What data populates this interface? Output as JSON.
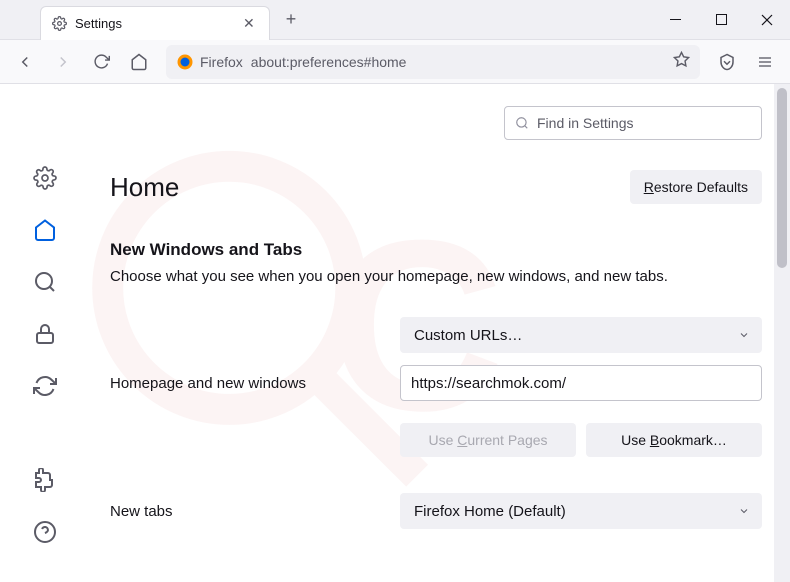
{
  "tab": {
    "title": "Settings"
  },
  "urlbar": {
    "identity": "Firefox",
    "url": "about:preferences#home"
  },
  "search": {
    "placeholder": "Find in Settings"
  },
  "page": {
    "heading": "Home",
    "restore": "Restore Defaults",
    "section_title": "New Windows and Tabs",
    "section_desc": "Choose what you see when you open your homepage, new windows, and new tabs.",
    "homepage_label": "Homepage and new windows",
    "homepage_mode": "Custom URLs…",
    "homepage_value": "https://searchmok.com/",
    "use_current": "Use Current Pages",
    "use_bookmark": "Use Bookmark…",
    "newtabs_label": "New tabs",
    "newtabs_mode": "Firefox Home (Default)"
  }
}
